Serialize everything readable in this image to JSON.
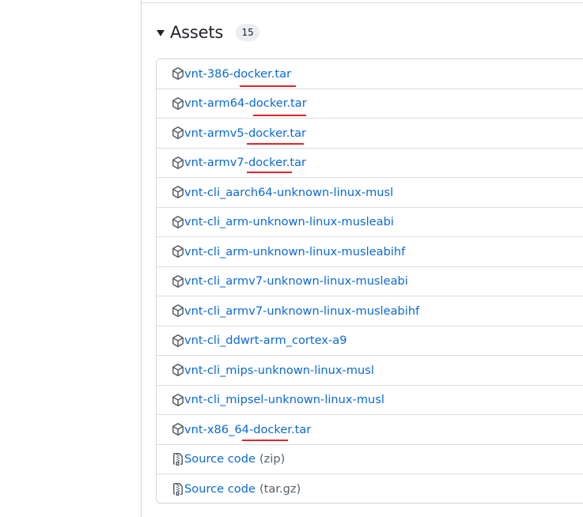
{
  "assets": {
    "title": "Assets",
    "count": "15",
    "items": [
      {
        "label": "vnt-386-docker.tar",
        "suffix": "",
        "icon": "package-icon"
      },
      {
        "label": "vnt-arm64-docker.tar",
        "suffix": "",
        "icon": "package-icon"
      },
      {
        "label": "vnt-armv5-docker.tar",
        "suffix": "",
        "icon": "package-icon"
      },
      {
        "label": "vnt-armv7-docker.tar",
        "suffix": "",
        "icon": "package-icon"
      },
      {
        "label": "vnt-cli_aarch64-unknown-linux-musl",
        "suffix": "",
        "icon": "package-icon"
      },
      {
        "label": "vnt-cli_arm-unknown-linux-musleabi",
        "suffix": "",
        "icon": "package-icon"
      },
      {
        "label": "vnt-cli_arm-unknown-linux-musleabihf",
        "suffix": "",
        "icon": "package-icon"
      },
      {
        "label": "vnt-cli_armv7-unknown-linux-musleabi",
        "suffix": "",
        "icon": "package-icon"
      },
      {
        "label": "vnt-cli_armv7-unknown-linux-musleabihf",
        "suffix": "",
        "icon": "package-icon"
      },
      {
        "label": "vnt-cli_ddwrt-arm_cortex-a9",
        "suffix": "",
        "icon": "package-icon"
      },
      {
        "label": "vnt-cli_mips-unknown-linux-musl",
        "suffix": "",
        "icon": "package-icon"
      },
      {
        "label": "vnt-cli_mipsel-unknown-linux-musl",
        "suffix": "",
        "icon": "package-icon"
      },
      {
        "label": "vnt-x86_64-docker.tar",
        "suffix": "",
        "icon": "package-icon"
      },
      {
        "label": "Source code",
        "suffix": "(zip)",
        "icon": "file-zip-icon"
      },
      {
        "label": "Source code",
        "suffix": "(tar.gz)",
        "icon": "file-zip-icon"
      }
    ]
  },
  "colors": {
    "link": "#0969da",
    "muted": "#57606a",
    "border": "#d0d7de",
    "annotation_underline": "#e0242b"
  }
}
